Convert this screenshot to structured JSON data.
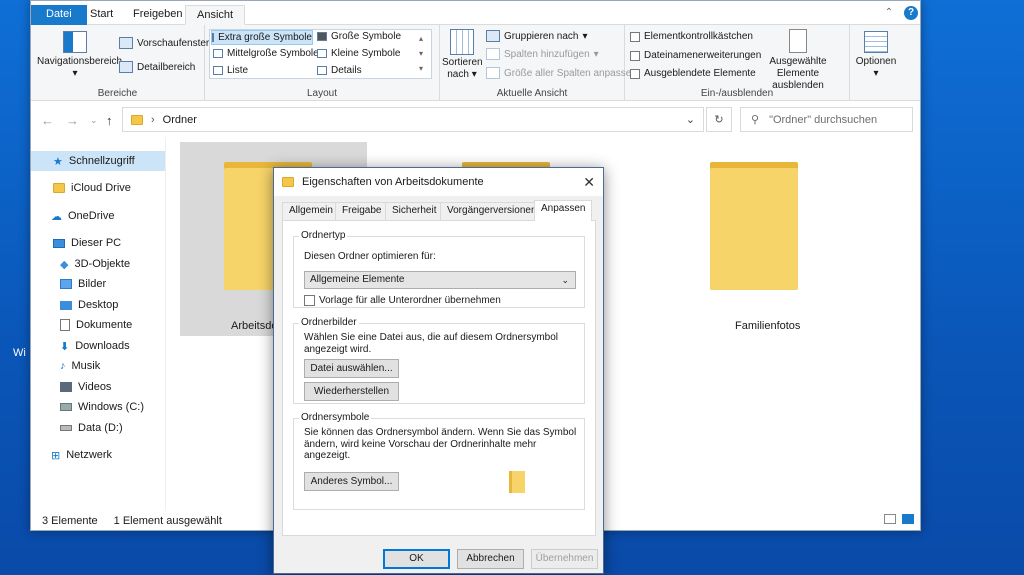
{
  "desktop": {
    "label": "Wi"
  },
  "ribbon_tabs": [
    "Datei",
    "Start",
    "Freigeben",
    "Ansicht"
  ],
  "ribbon": {
    "bereiche": {
      "label": "Bereiche",
      "nav": "Navigationsbereich",
      "preview": "Vorschaufenster",
      "details": "Detailbereich"
    },
    "layout": {
      "label": "Layout",
      "items": [
        "Extra große Symbole",
        "Große Symbole",
        "Mittelgroße Symbole",
        "Kleine Symbole",
        "Liste",
        "Details"
      ]
    },
    "view": {
      "label": "Aktuelle Ansicht",
      "sort": "Sortieren nach",
      "group": "Gruppieren nach",
      "add_cols": "Spalten hinzufügen",
      "fit_cols": "Größe aller Spalten anpassen"
    },
    "show": {
      "label": "Ein-/ausblenden",
      "checkboxes": "Elementkontrollkästchen",
      "extensions": "Dateinamenerweiterungen",
      "hidden": "Ausgeblendete Elemente",
      "hide_sel": "Ausgewählte Elemente ausblenden"
    },
    "options": {
      "label": "Optionen"
    }
  },
  "address": {
    "path": "Ordner",
    "search_placeholder": "\"Ordner\" durchsuchen"
  },
  "nav_items": [
    "Schnellzugriff",
    "iCloud Drive",
    "OneDrive",
    "Dieser PC",
    "3D-Objekte",
    "Bilder",
    "Desktop",
    "Dokumente",
    "Downloads",
    "Musik",
    "Videos",
    "Windows (C:)",
    "Data (D:)",
    "Netzwerk"
  ],
  "folders": [
    "Arbeitsdo",
    "Familienfotos"
  ],
  "status": {
    "count": "3 Elemente",
    "selected": "1 Element ausgewählt"
  },
  "dialog": {
    "title": "Eigenschaften von Arbeitsdokumente",
    "tabs": [
      "Allgemein",
      "Freigabe",
      "Sicherheit",
      "Vorgängerversionen",
      "Anpassen"
    ],
    "ordnertyp": {
      "legend": "Ordnertyp",
      "label": "Diesen Ordner optimieren für:",
      "value": "Allgemeine Elemente",
      "checkbox": "Vorlage für alle Unterordner übernehmen"
    },
    "ordnerbilder": {
      "legend": "Ordnerbilder",
      "text1": "Wählen Sie eine Datei aus, die auf diesem Ordnersymbol",
      "text2": "angezeigt wird.",
      "btn_choose": "Datei auswählen...",
      "btn_restore": "Wiederherstellen"
    },
    "ordnersymbole": {
      "legend": "Ordnersymbole",
      "text1": "Sie können das Ordnersymbol ändern. Wenn Sie das Symbol",
      "text2": "ändern, wird keine Vorschau der Ordnerinhalte mehr angezeigt.",
      "btn_other": "Anderes Symbol..."
    },
    "buttons": {
      "ok": "OK",
      "cancel": "Abbrechen",
      "apply": "Übernehmen"
    }
  }
}
